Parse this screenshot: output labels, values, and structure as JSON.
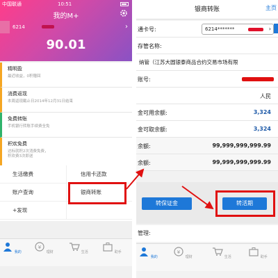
{
  "left": {
    "status": {
      "carrier": "中国联通",
      "time": "10:51"
    },
    "hero": {
      "title": "我的M+",
      "card_number": "6214",
      "balance": "90.01"
    },
    "items": [
      {
        "title": "精明盈",
        "sub": "最近收益，0积赠回"
      },
      {
        "title": "消费返现",
        "sub": "本周返现截止日2014年12月31日结束"
      },
      {
        "title": "免费转账",
        "sub": "手机银行转账手续费全免"
      },
      {
        "title": "积欢免费",
        "sub": "达标就积2次消费免费，\n积欢费3次即送"
      }
    ],
    "grid": [
      {
        "left": "生活缴费",
        "right": "信用卡还款"
      },
      {
        "left": "账户查询",
        "right": "银商转账"
      },
      {
        "left": "+发现",
        "right": ""
      }
    ],
    "tabs": [
      {
        "label": "我的",
        "icon": "person-icon"
      },
      {
        "label": "理财",
        "icon": "coin-icon"
      },
      {
        "label": "生活",
        "icon": "cart-icon"
      },
      {
        "label": "助手",
        "icon": "briefcase-icon"
      }
    ]
  },
  "right": {
    "title": "银商转账",
    "home": "主页",
    "rows": {
      "card_label": "通卡号:",
      "card_value": "6214*******",
      "name_label": "存管名称:",
      "name_value": "纳管（江苏大圆银泰商品合约交易市场有限",
      "account_label": "账号:",
      "currency_value": "人民",
      "avail_label": "金可用余额:",
      "avail_value": "3,324",
      "withdraw_label": "金可取余额:",
      "withdraw_value": "3,324",
      "bal1_label": "余额:",
      "bal1_value": "99,999,999,999.99",
      "bal2_label": "余额:",
      "bal2_value": "99,999,999,999.99"
    },
    "buttons": {
      "b1": "转保证金",
      "b2": "转活期"
    },
    "notes": "管理:",
    "tabs": [
      {
        "label": "我的",
        "icon": "person-icon"
      },
      {
        "label": "理财",
        "icon": "coin-icon"
      },
      {
        "label": "生活",
        "icon": "cart-icon"
      },
      {
        "label": "助手",
        "icon": "briefcase-icon"
      }
    ]
  },
  "colors": {
    "accent_blue": "#1e78d8",
    "highlight_red": "#e01010",
    "hero_pink": "#ff3d8a",
    "hero_purple": "#8a52c4"
  }
}
